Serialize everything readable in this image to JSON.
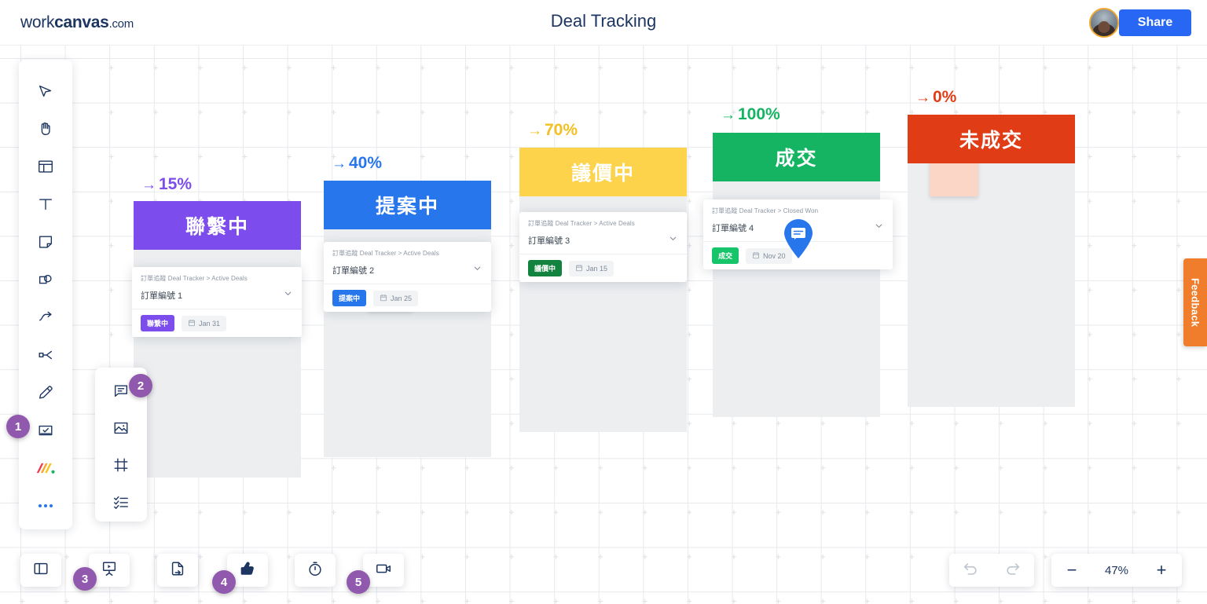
{
  "header": {
    "logo_light": "work",
    "logo_bold": "canvas",
    "logo_tld": ".com",
    "title": "Deal Tracking",
    "share_label": "Share",
    "avatar_name": "user-avatar"
  },
  "toolbar": {
    "items": [
      {
        "icon": "cursor-select-icon",
        "name": "tool-select"
      },
      {
        "icon": "hand-pan-icon",
        "name": "tool-hand"
      },
      {
        "icon": "template-layout-icon",
        "name": "tool-template"
      },
      {
        "icon": "text-icon",
        "name": "tool-text"
      },
      {
        "icon": "sticky-note-icon",
        "name": "tool-sticky-note"
      },
      {
        "icon": "shapes-icon",
        "name": "tool-shapes"
      },
      {
        "icon": "connector-arrow-icon",
        "name": "tool-connector"
      },
      {
        "icon": "scissors-icon",
        "name": "tool-cut"
      },
      {
        "icon": "pencil-icon",
        "name": "tool-pen"
      },
      {
        "icon": "task-checkbox-icon",
        "name": "tool-task"
      },
      {
        "icon": "workcanvas-logo-icon",
        "name": "tool-apps"
      },
      {
        "icon": "more-dots-icon",
        "name": "tool-more"
      }
    ]
  },
  "submenu": {
    "items": [
      {
        "icon": "comment-icon",
        "name": "submenu-comment"
      },
      {
        "icon": "image-icon",
        "name": "submenu-image"
      },
      {
        "icon": "frame-icon",
        "name": "submenu-frame"
      },
      {
        "icon": "checklist-icon",
        "name": "submenu-checklist"
      }
    ]
  },
  "step_badges": [
    {
      "label": "1"
    },
    {
      "label": "2"
    },
    {
      "label": "3"
    },
    {
      "label": "4"
    },
    {
      "label": "5"
    }
  ],
  "columns": [
    {
      "percent": "15%",
      "arrow": "→",
      "stage": "聯繫中",
      "header_color": "#7c4dec",
      "percent_color": "#7c4dec",
      "sticky_color": "#c9aaf5",
      "card": {
        "breadcrumb": "訂單追蹤 Deal Tracker > Active Deals",
        "deal_name": "訂單編號 1",
        "tag": "聯繫中",
        "tag_color": "#7c4dec",
        "date": "Jan 31"
      }
    },
    {
      "percent": "40%",
      "arrow": "→",
      "stage": "提案中",
      "header_color": "#2776ec",
      "percent_color": "#2776ec",
      "sticky_color": "#a8c9f5",
      "card": {
        "breadcrumb": "訂單追蹤 Deal Tracker > Active Deals",
        "deal_name": "訂單編號 2",
        "tag": "提案中",
        "tag_color": "#2776ec",
        "date": "Jan 25"
      }
    },
    {
      "percent": "70%",
      "arrow": "→",
      "stage": "議價中",
      "header_color": "#fcd34a",
      "percent_color": "#f3c023",
      "sticky_color": "#f0c36b",
      "card": {
        "breadcrumb": "訂單追蹤 Deal Tracker > Active Deals",
        "deal_name": "訂單編號 3",
        "tag": "議價中",
        "tag_color": "#11833f",
        "date": "Jan 15"
      }
    },
    {
      "percent": "100%",
      "arrow": "→",
      "stage": "成交",
      "header_color": "#14b462",
      "percent_color": "#14b462",
      "sticky_color": "#9fe3c0",
      "card": {
        "breadcrumb": "訂單追蹤 Deal Tracker > Closed Won",
        "deal_name": "訂單編號 4",
        "tag": "成交",
        "tag_color": "#16c46a",
        "date": "Nov 20"
      }
    },
    {
      "percent": "0%",
      "arrow": "→",
      "stage": "未成交",
      "header_color": "#e03c16",
      "percent_color": "#e03c16",
      "sticky_color": "#fbd5c6",
      "card": null
    }
  ],
  "comment_pin": {
    "icon": "comment-pin-icon",
    "color": "#2776ec"
  },
  "feedback": {
    "label": "Feedback",
    "color": "#f07d2b"
  },
  "bottom_bar": {
    "left_items": [
      {
        "icon": "panel-toggle-icon",
        "name": "toggle-sidebar-button"
      },
      {
        "icon": "presentation-icon",
        "name": "presentation-button"
      },
      {
        "icon": "export-file-icon",
        "name": "export-button"
      },
      {
        "icon": "thumbs-up-icon",
        "name": "reaction-button"
      },
      {
        "icon": "timer-icon",
        "name": "timer-button"
      },
      {
        "icon": "video-camera-icon",
        "name": "video-button"
      }
    ],
    "undo_label": "undo-icon",
    "redo_label": "redo-icon",
    "zoom_out": "−",
    "zoom_level": "47%",
    "zoom_in": "+"
  }
}
